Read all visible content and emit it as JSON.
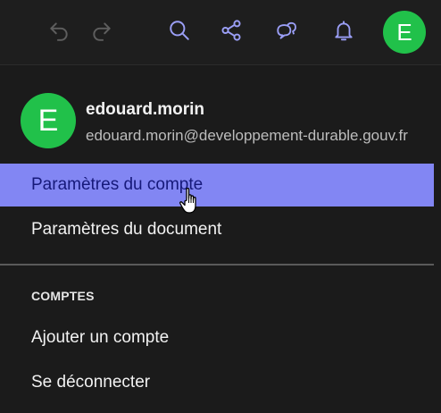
{
  "topbar": {
    "icons": [
      "undo-icon",
      "redo-icon",
      "search-icon",
      "share-icon",
      "chat-icon",
      "bell-icon"
    ],
    "avatar_initial": "E"
  },
  "account": {
    "avatar_initial": "E",
    "username": "edouard.morin",
    "email": "edouard.morin@developpement-durable.gouv.fr"
  },
  "menu": {
    "account_settings": "Paramètres du compte",
    "document_settings": "Paramètres du document",
    "section_accounts": "COMPTES",
    "add_account": "Ajouter un compte",
    "sign_out": "Se déconnecter"
  },
  "colors": {
    "accent": "#8286f3",
    "avatar": "#21c14a",
    "icon_active": "#9b9ff7",
    "icon_disabled": "#5e5e5e"
  }
}
